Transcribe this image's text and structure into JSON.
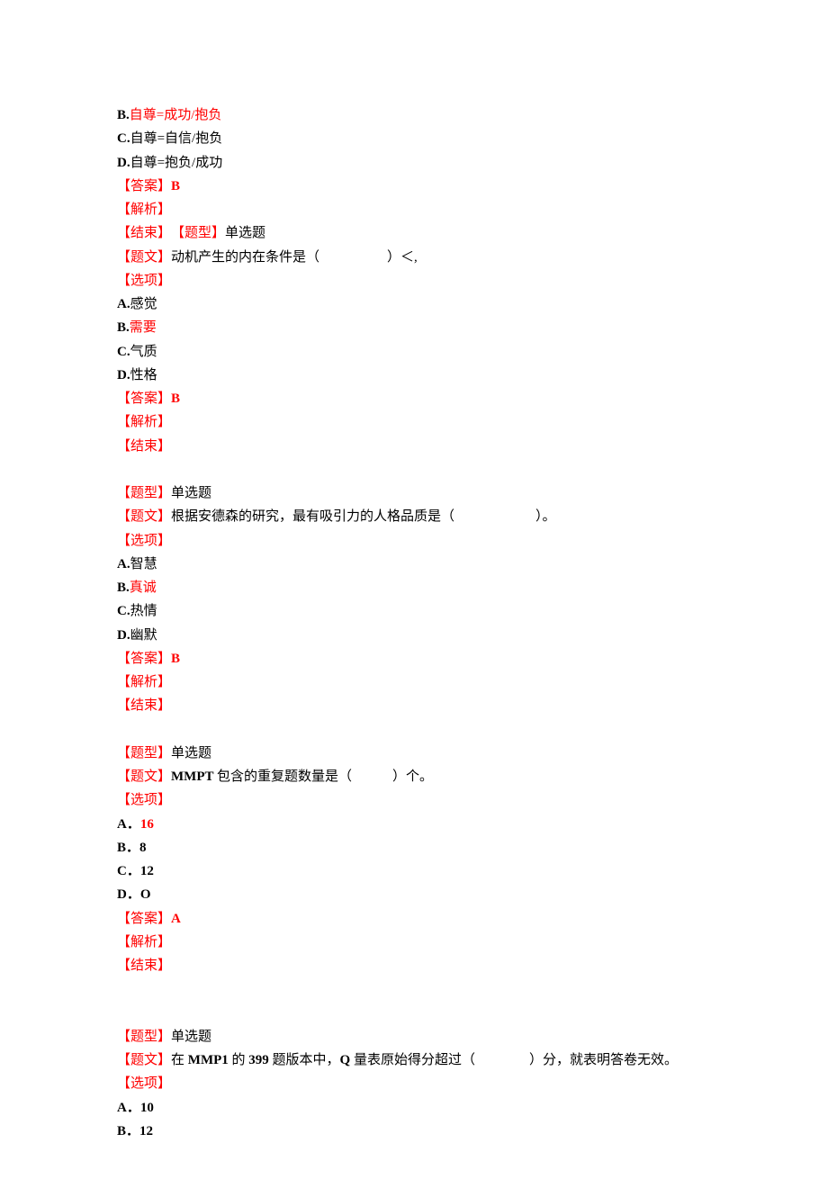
{
  "q1": {
    "optB_prefix": "B.",
    "optB_text": "自尊=成功/抱负",
    "optC_prefix": "C.",
    "optC_text": "自尊=自信/抱负",
    "optD_prefix": "D.",
    "optD_text": "自尊=抱负/成功",
    "answer_label": "【答案】",
    "answer_val": "B",
    "jiexi": "【解析】",
    "jieshu": "【结束】",
    "tixing_label": "【题型】",
    "tixing_val": "单选题"
  },
  "q2": {
    "tiwen_label": "【题文】",
    "tiwen_text": "动机产生的内在条件是（　　　　　）＜,",
    "xuanxiang": "【选项】",
    "optA_prefix": "A.",
    "optA_text": "感觉",
    "optB_prefix": "B.",
    "optB_text": "需要",
    "optC_prefix": "C.",
    "optC_text": "气质",
    "optD_prefix": "D.",
    "optD_text": "性格",
    "answer_label": "【答案】",
    "answer_val": "B",
    "jiexi": "【解析】",
    "jieshu": "【结束】"
  },
  "q3": {
    "tixing_label": "【题型】",
    "tixing_val": "单选题",
    "tiwen_label": "【题文】",
    "tiwen_text": "根据安德森的研究，最有吸引力的人格品质是（　　　　　　）。",
    "xuanxiang": "【选项】",
    "optA_prefix": "A.",
    "optA_text": "智慧",
    "optB_prefix": "B.",
    "optB_text": "真诚",
    "optC_prefix": "C.",
    "optC_text": "热情",
    "optD_prefix": "D.",
    "optD_text": "幽默",
    "answer_label": "【答案】",
    "answer_val": "B",
    "jiexi": "【解析】",
    "jieshu": "【结束】"
  },
  "q4": {
    "tixing_label": "【题型】",
    "tixing_val": "单选题",
    "tiwen_label": "【题文】",
    "tiwen_text1": "MMPT ",
    "tiwen_text2": "包含的重复题数量是（　　　）个。",
    "xuanxiang": "【选项】",
    "optA_prefix": "A．",
    "optA_text": "16",
    "optB_prefix": "B．",
    "optB_text": "8",
    "optC_prefix": "C．",
    "optC_text": "12",
    "optD_prefix": "D．",
    "optD_text": "O",
    "answer_label": "【答案】",
    "answer_val": "A",
    "jiexi": "【解析】",
    "jieshu": "【结束】"
  },
  "q5": {
    "tixing_label": "【题型】",
    "tixing_val": "单选题",
    "tiwen_label": "【题文】",
    "tiwen_text1": "在 ",
    "tiwen_text2": "MMP1 ",
    "tiwen_text3": "的 ",
    "tiwen_text4": "399 ",
    "tiwen_text5": "题版本中，",
    "tiwen_text6": "Q ",
    "tiwen_text7": "量表原始得分超过（　　　　）分，就表明答卷无效。",
    "xuanxiang": "【选项】",
    "optA_prefix": "A．",
    "optA_text": "10",
    "optB_prefix": "B．",
    "optB_text": "12"
  }
}
